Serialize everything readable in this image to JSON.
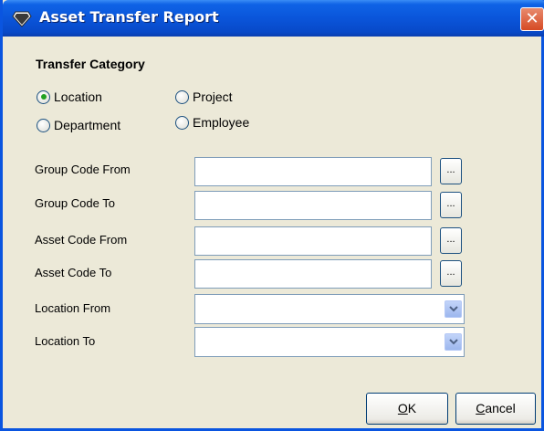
{
  "window": {
    "title": "Asset Transfer Report"
  },
  "transfer_category": {
    "heading": "Transfer Category",
    "options": [
      {
        "label": "Location",
        "checked": true
      },
      {
        "label": "Project",
        "checked": false
      },
      {
        "label": "Department",
        "checked": false
      },
      {
        "label": "Employee",
        "checked": false
      }
    ]
  },
  "fields": {
    "group_code_from": {
      "label": "Group Code From",
      "value": "",
      "browse_label": "..."
    },
    "group_code_to": {
      "label": "Group Code To",
      "value": "",
      "browse_label": "..."
    },
    "asset_code_from": {
      "label": "Asset Code From",
      "value": "",
      "browse_label": "..."
    },
    "asset_code_to": {
      "label": "Asset Code To",
      "value": "",
      "browse_label": "..."
    },
    "location_from": {
      "label": "Location From",
      "value": ""
    },
    "location_to": {
      "label": "Location To",
      "value": ""
    }
  },
  "buttons": {
    "ok_mnemonic": "O",
    "ok_rest": "K",
    "cancel_mnemonic": "C",
    "cancel_rest": "ancel"
  },
  "colors": {
    "titlebar": "#0A55DA",
    "dialog_bg": "#ECE9D8",
    "radio_selected": "#21A121",
    "close_button": "#D64A24"
  },
  "icons": {
    "title": "gem-icon",
    "close": "close-icon",
    "dropdown": "chevron-down-icon"
  }
}
